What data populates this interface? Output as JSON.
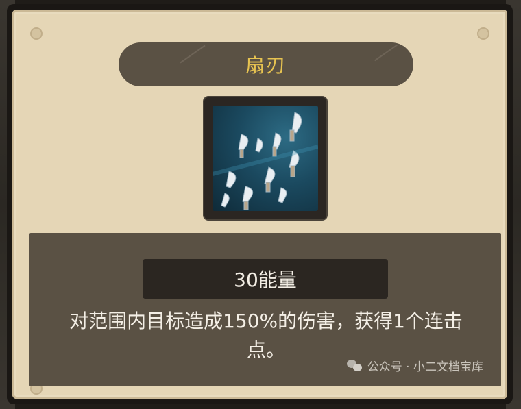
{
  "card": {
    "title": "扇刃",
    "energy_cost": "30能量",
    "description": "对范围内目标造成150%的伤害，获得1个连击点。"
  },
  "skill_icon": {
    "name": "fan-blades-icon"
  },
  "watermark": {
    "text": "公众号 · 小二文档宝库"
  },
  "colors": {
    "parchment": "#e5d6b6",
    "title_bar": "#5a5144",
    "title_text": "#e7c351",
    "panel": "#5a5144",
    "energy_box": "#2b2621",
    "text_light": "#f4efe6"
  }
}
